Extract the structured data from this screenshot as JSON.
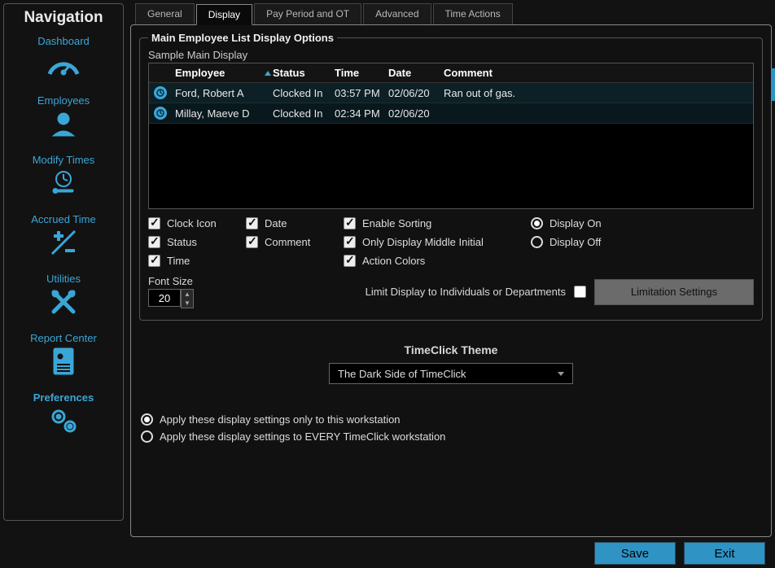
{
  "nav": {
    "title": "Navigation",
    "items": [
      {
        "label": "Dashboard"
      },
      {
        "label": "Employees"
      },
      {
        "label": "Modify Times"
      },
      {
        "label": "Accrued Time"
      },
      {
        "label": "Utilities"
      },
      {
        "label": "Report Center"
      },
      {
        "label": "Preferences"
      }
    ]
  },
  "tabs": [
    {
      "label": "General"
    },
    {
      "label": "Display"
    },
    {
      "label": "Pay Period and OT"
    },
    {
      "label": "Advanced"
    },
    {
      "label": "Time Actions"
    }
  ],
  "group": {
    "legend": "Main Employee List Display Options",
    "subcaption": "Sample Main Display",
    "columns": {
      "employee": "Employee",
      "status": "Status",
      "time": "Time",
      "date": "Date",
      "comment": "Comment"
    },
    "rows": [
      {
        "employee": "Ford, Robert A",
        "status": "Clocked In",
        "time": "03:57 PM",
        "date": "02/06/20",
        "comment": "Ran out of gas."
      },
      {
        "employee": "Millay, Maeve D",
        "status": "Clocked In",
        "time": "02:34 PM",
        "date": "02/06/20",
        "comment": ""
      }
    ],
    "checks": {
      "clock_icon": "Clock Icon",
      "date": "Date",
      "enable_sorting": "Enable Sorting",
      "status": "Status",
      "comment": "Comment",
      "only_mi": "Only Display Middle Initial",
      "time": "Time",
      "action_colors": "Action Colors"
    },
    "radios": {
      "display_on": "Display On",
      "display_off": "Display Off"
    },
    "font_size_label": "Font Size",
    "font_size_value": "20",
    "limit_label": "Limit Display to Individuals or Departments",
    "limit_button": "Limitation Settings"
  },
  "theme": {
    "label": "TimeClick Theme",
    "value": "The Dark Side of TimeClick"
  },
  "apply": {
    "only_this": "Apply these display settings only to this workstation",
    "every": "Apply these display settings to EVERY TimeClick workstation"
  },
  "buttons": {
    "save": "Save",
    "exit": "Exit"
  }
}
